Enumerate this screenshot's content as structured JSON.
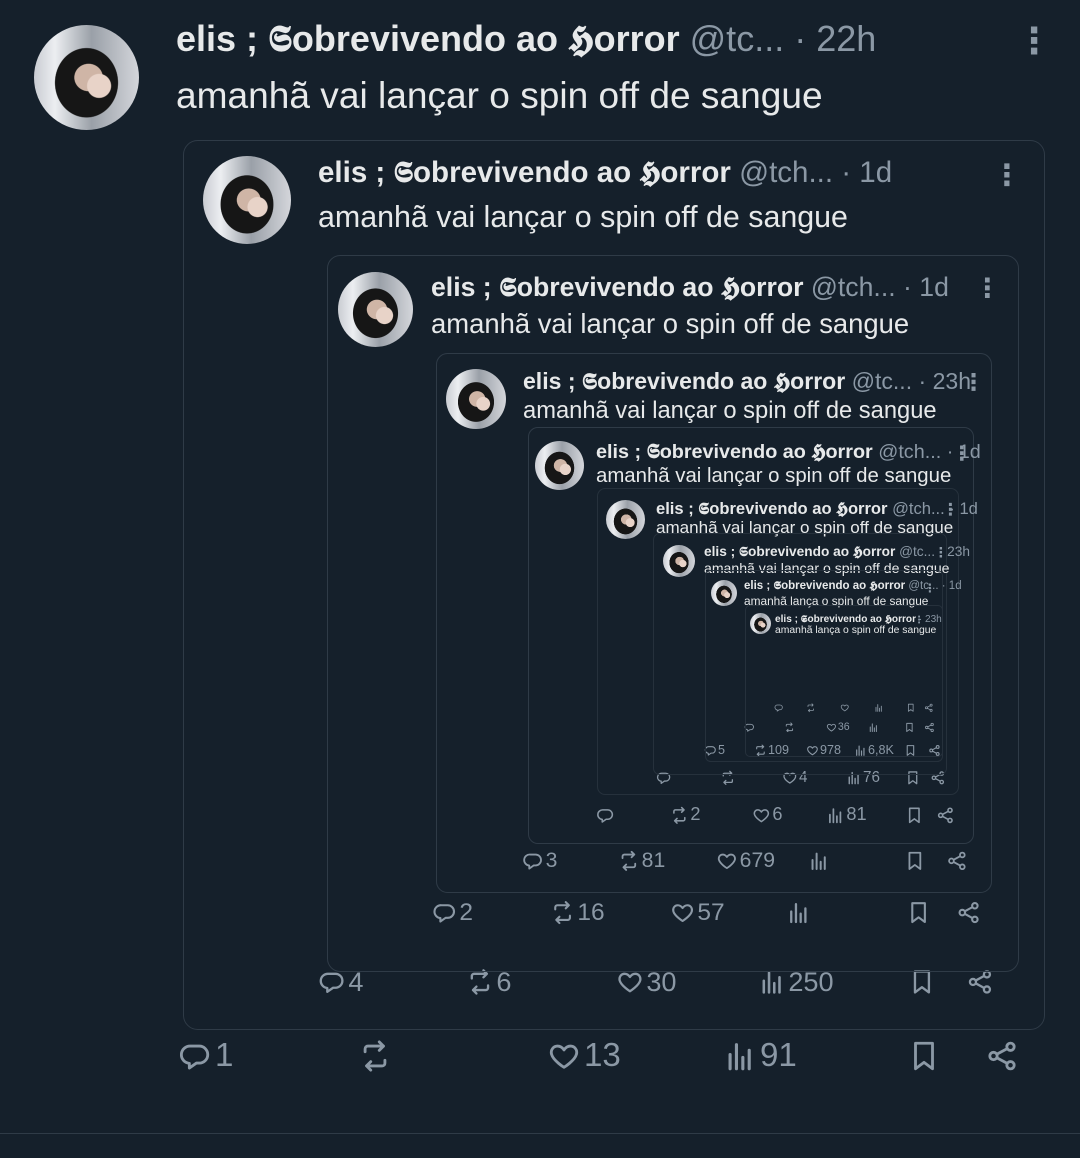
{
  "tweet": {
    "author": "elis ; 𝕾obrevivendo ao 𝕳orror",
    "handle": "@tc...",
    "time": "· 22h",
    "text": "amanhã vai lançar o spin off de sangue",
    "stats": {
      "reply": "1",
      "retweet": "",
      "like": "13",
      "views": "91"
    }
  },
  "quotes": [
    {
      "author": "elis ; 𝕾obrevivendo ao 𝕳orror",
      "handle": "@tch...",
      "time": "· 1d",
      "text": "amanhã vai lançar o spin off de sangue",
      "stats": {
        "reply": "4",
        "retweet": "6",
        "like": "30",
        "views": "250"
      }
    },
    {
      "author": "elis ; 𝕾obrevivendo ao 𝕳orror",
      "handle": "@tch...",
      "time": "· 1d",
      "text": "amanhã vai lançar o spin off de sangue",
      "stats": {
        "reply": "2",
        "retweet": "16",
        "like": "57",
        "views": ""
      }
    },
    {
      "author": "elis ; 𝕾obrevivendo ao 𝕳orror",
      "handle": "@tc...",
      "time": "· 23h",
      "text": "amanhã vai lançar o spin off de sangue",
      "stats": {
        "reply": "3",
        "retweet": "81",
        "like": "679",
        "views": ""
      }
    },
    {
      "author": "elis ; 𝕾obrevivendo ao 𝕳orror",
      "handle": "@tch...",
      "time": "· 1d",
      "text": "amanhã vai lançar o spin off de sangue",
      "stats": {
        "reply": "",
        "retweet": "2",
        "like": "6",
        "views": "81"
      }
    },
    {
      "author": "elis ; 𝕾obrevivendo ao 𝕳orror",
      "handle": "@tch...",
      "time": "· 1d",
      "text": "amanhã vai lançar o spin off de sangue",
      "stats": {
        "reply": "",
        "retweet": "",
        "like": "4",
        "views": "76"
      }
    },
    {
      "author": "elis ; 𝕾obrevivendo ao 𝕳orror",
      "handle": "@tc...",
      "time": "· 23h",
      "text": "amanhã vai lançar o spin off de sangue",
      "stats": {
        "reply": "5",
        "retweet": "109",
        "like": "978",
        "views": "6,8K"
      }
    },
    {
      "author": "elis ; 𝕾obrevivendo ao 𝕳orror",
      "handle": "@tc...",
      "time": "· 1d",
      "text": "amanhã lança o spin off de sangue",
      "stats": {
        "reply": "",
        "retweet": "",
        "like": "36",
        "views": ""
      }
    },
    {
      "author": "elis ; 𝕾obrevivendo ao 𝕳orror",
      "handle": "",
      "time": "· 23h",
      "text": "amanhã lança o spin off de sangue",
      "stats": {
        "reply": "",
        "retweet": "",
        "like": "",
        "views": ""
      }
    }
  ]
}
